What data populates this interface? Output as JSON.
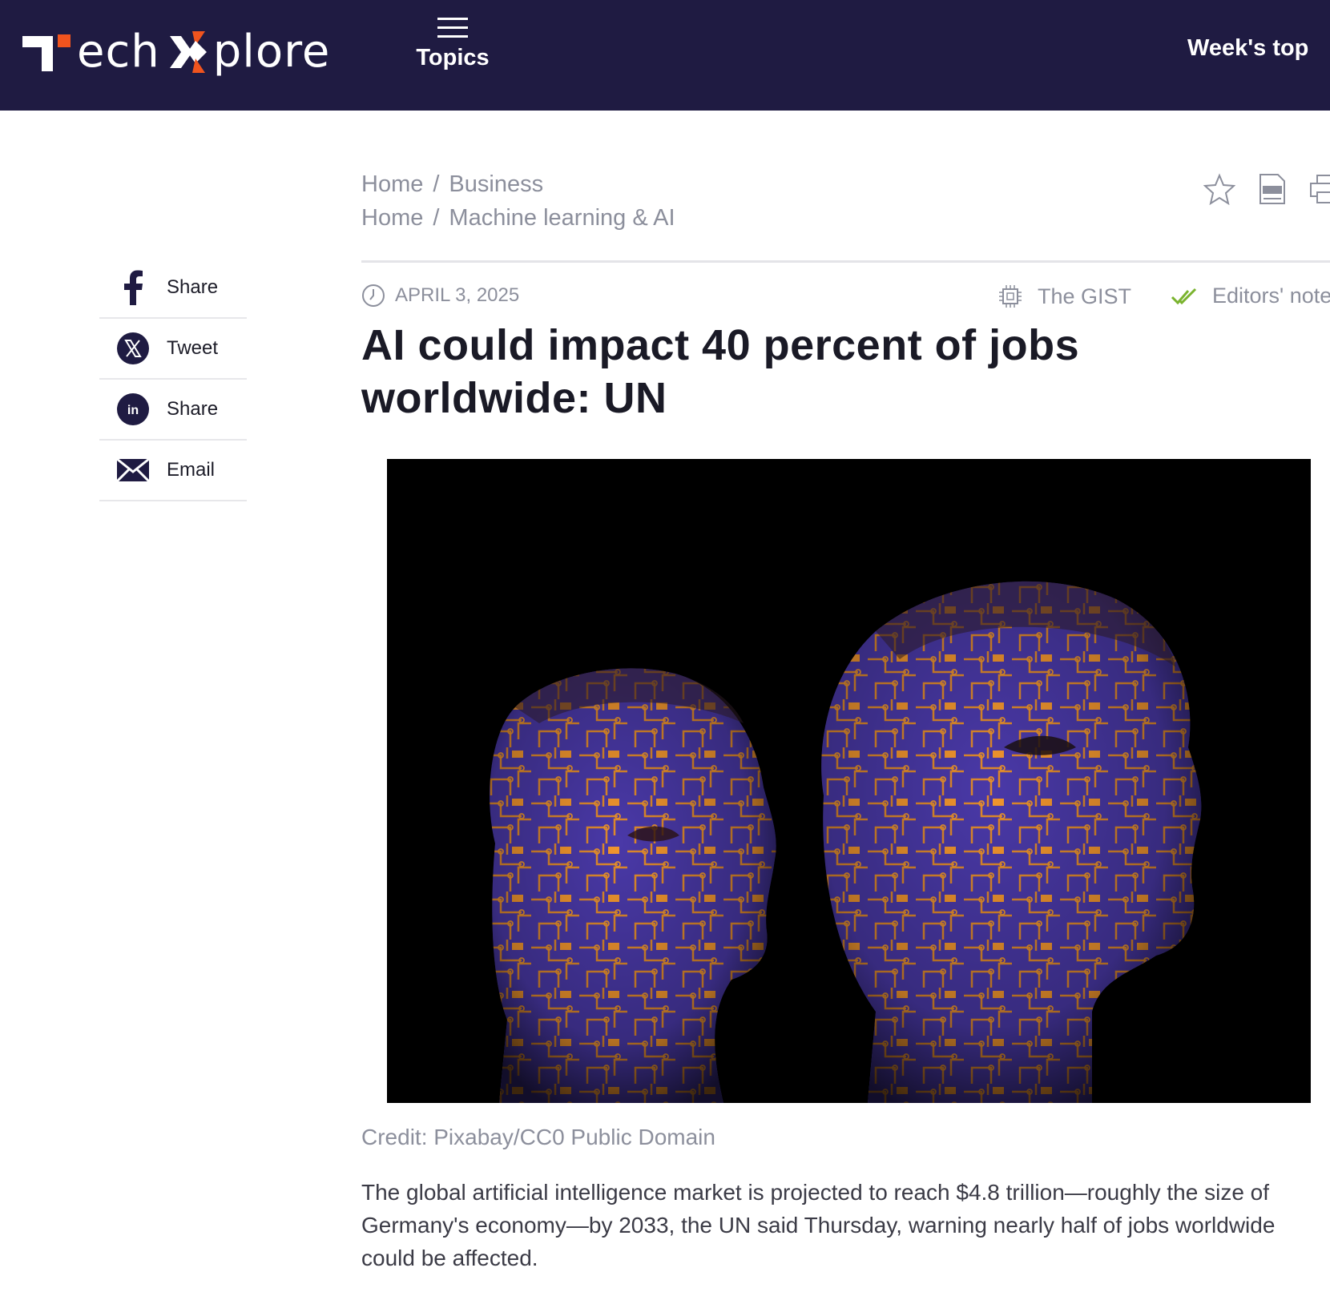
{
  "header": {
    "logo_text_left": "ech",
    "logo_text_right": "plore",
    "topics_label": "Topics",
    "weeks_top_label": "Week's top"
  },
  "breadcrumbs": [
    {
      "home": "Home",
      "section": "Business"
    },
    {
      "home": "Home",
      "section": "Machine learning & AI"
    }
  ],
  "tools": [
    {
      "icon": "star-icon"
    },
    {
      "icon": "pdf-icon"
    },
    {
      "icon": "print-icon"
    }
  ],
  "share": [
    {
      "icon": "facebook-icon",
      "label": "Share"
    },
    {
      "icon": "x-icon",
      "label": "Tweet"
    },
    {
      "icon": "linkedin-icon",
      "label": "Share"
    },
    {
      "icon": "email-icon",
      "label": "Email"
    }
  ],
  "article": {
    "date": "APRIL 3, 2025",
    "gist_label": "The GIST",
    "editors_label": "Editors' notes",
    "headline": "AI could impact 40 percent of jobs worldwide: UN",
    "image_alt": "Two human heads overlaid with an orange circuit-board pattern on a purple skin tone",
    "credit": "Credit: Pixabay/CC0 Public Domain",
    "body": "The global artificial intelligence market is projected to reach $4.8 trillion—roughly the size of Germany's economy—by 2033, the UN said Thursday, warning nearly half of jobs worldwide could be affected."
  },
  "colors": {
    "header_bg": "#1f1b42",
    "logo_accent": "#f0541e",
    "muted_text": "#8c8f9c",
    "check_green": "#7ab32e"
  }
}
